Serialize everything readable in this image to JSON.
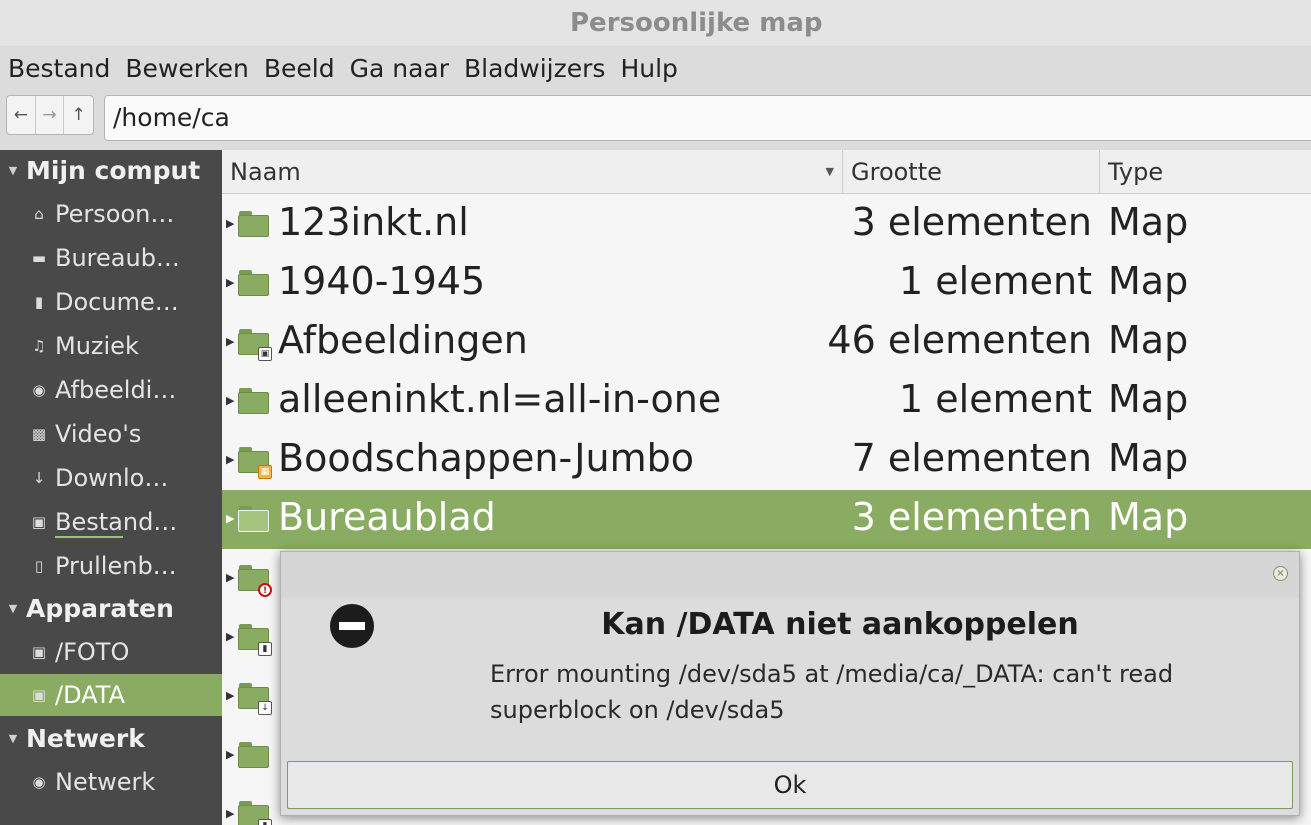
{
  "window": {
    "title": "Persoonlijke map"
  },
  "menu": [
    "Bestand",
    "Bewerken",
    "Beeld",
    "Ga naar",
    "Bladwijzers",
    "Hulp"
  ],
  "location": {
    "path": "/home/ca"
  },
  "sidebar": {
    "sections": {
      "computer": "Mijn comput",
      "devices": "Apparaten",
      "network": "Netwerk"
    },
    "items": [
      {
        "label": "Persoon…",
        "icon": "home-icon"
      },
      {
        "label": "Bureaub…",
        "icon": "desktop-icon"
      },
      {
        "label": "Docume…",
        "icon": "document-icon"
      },
      {
        "label": "Muziek",
        "icon": "music-icon"
      },
      {
        "label": "Afbeeldi…",
        "icon": "camera-icon"
      },
      {
        "label": "Video's",
        "icon": "film-icon"
      },
      {
        "label": "Downlo…",
        "icon": "download-icon"
      },
      {
        "label": "Bestand…",
        "icon": "drive-icon"
      },
      {
        "label": "Prullenb…",
        "icon": "trash-icon"
      },
      {
        "label": "/FOTO",
        "icon": "drive-icon"
      },
      {
        "label": "/DATA",
        "icon": "drive-icon"
      },
      {
        "label": "Netwerk",
        "icon": "network-icon"
      }
    ],
    "selected": "/DATA"
  },
  "columns": {
    "name": "Naam",
    "size": "Grootte",
    "type": "Type"
  },
  "files": [
    {
      "name": "123inkt.nl",
      "size": "3 elementen",
      "type": "Map"
    },
    {
      "name": "1940-1945",
      "size": "1 element",
      "type": "Map"
    },
    {
      "name": "Afbeeldingen",
      "size": "46 elementen",
      "type": "Map"
    },
    {
      "name": "alleeninkt.nl=all-in-one",
      "size": "1 element",
      "type": "Map"
    },
    {
      "name": "Boodschappen-Jumbo",
      "size": "7 elementen",
      "type": "Map"
    },
    {
      "name": "Bureaublad",
      "size": "3 elementen",
      "type": "Map"
    }
  ],
  "selected_file": "Bureaublad",
  "dialog": {
    "heading": "Kan /DATA niet aankoppelen",
    "message": "Error mounting /dev/sda5 at /media/ca/_DATA: can't read superblock on /dev/sda5",
    "ok_label": "Ok"
  }
}
